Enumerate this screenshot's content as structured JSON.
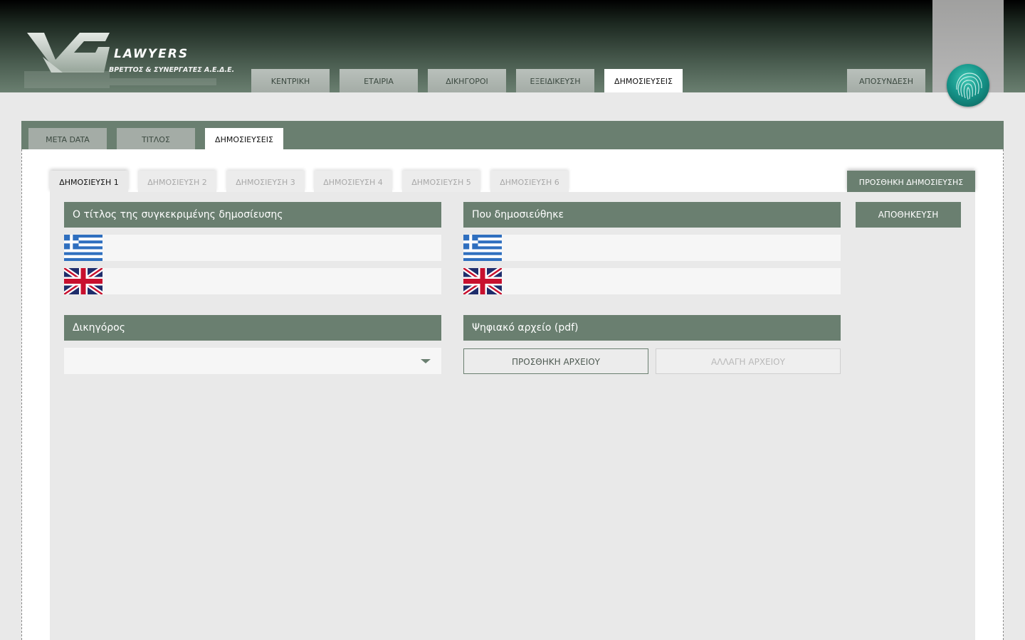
{
  "header": {
    "logo": {
      "mark": "VG",
      "title": "LAWYERS",
      "subtitle": "ΒΡΕΤΤΟΣ & ΣΥΝΕΡΓΑΤΕΣ Α.Ε.Δ.Ε."
    },
    "nav": [
      {
        "label": "ΚΕΝΤΡΙΚΗ",
        "active": false
      },
      {
        "label": "ΕΤΑΙΡΙΑ",
        "active": false
      },
      {
        "label": "ΔΙΚΗΓΟΡΟΙ",
        "active": false
      },
      {
        "label": "ΕΞΕΙΔΙΚΕΥΣΗ",
        "active": false
      },
      {
        "label": "ΔΗΜΟΣΙΕΥΣΕΙΣ",
        "active": true
      }
    ],
    "logout_label": "ΑΠΟΣΥΝΔΕΣΗ",
    "fingerprint_icon": "fingerprint-icon"
  },
  "panel": {
    "tabs": [
      {
        "label": "META DATA",
        "active": false
      },
      {
        "label": "ΤΙΤΛΟΣ",
        "active": false
      },
      {
        "label": "ΔΗΜΟΣΙΕΥΣΕΙΣ",
        "active": true
      }
    ]
  },
  "publications": {
    "tabs": [
      {
        "label": "ΔΗΜΟΣΙΕΥΣΗ 1",
        "active": true
      },
      {
        "label": "ΔΗΜΟΣΙΕΥΣΗ  2",
        "active": false
      },
      {
        "label": "ΔΗΜΟΣΙΕΥΣΗ  3",
        "active": false
      },
      {
        "label": "ΔΗΜΟΣΙΕΥΣΗ  4",
        "active": false
      },
      {
        "label": "ΔΗΜΟΣΙΕΥΣΗ 5",
        "active": false
      },
      {
        "label": "ΔΗΜΟΣΙΕΥΣΗ  6",
        "active": false
      }
    ],
    "add_label": "ΠΡΟΣΘΗΚΗ ΔΗΜΟΣΙΕΥΣΗΣ"
  },
  "form": {
    "title_section": {
      "heading": "Ο τίτλος της συγκεκριμένης δημοσίευσης",
      "greek_value": "",
      "english_value": ""
    },
    "where_section": {
      "heading": "Που δημοσιεύθηκε",
      "greek_value": "",
      "english_value": ""
    },
    "save_label": "ΑΠΟΘΗΚΕΥΣΗ",
    "lawyer_section": {
      "heading": "Δικηγόρος",
      "selected": ""
    },
    "file_section": {
      "heading": "Ψηφιακό αρχείο (pdf)",
      "add_label": "ΠΡΟΣΘΗΚΗ ΑΡΧΕΙΟΥ",
      "change_label": "ΑΛΛΑΓΗ ΑΡΧΕΙΟΥ"
    }
  },
  "colors": {
    "accent": "#6a7f70",
    "background": "#e9e9e9",
    "fingerprint": "#16958a"
  }
}
